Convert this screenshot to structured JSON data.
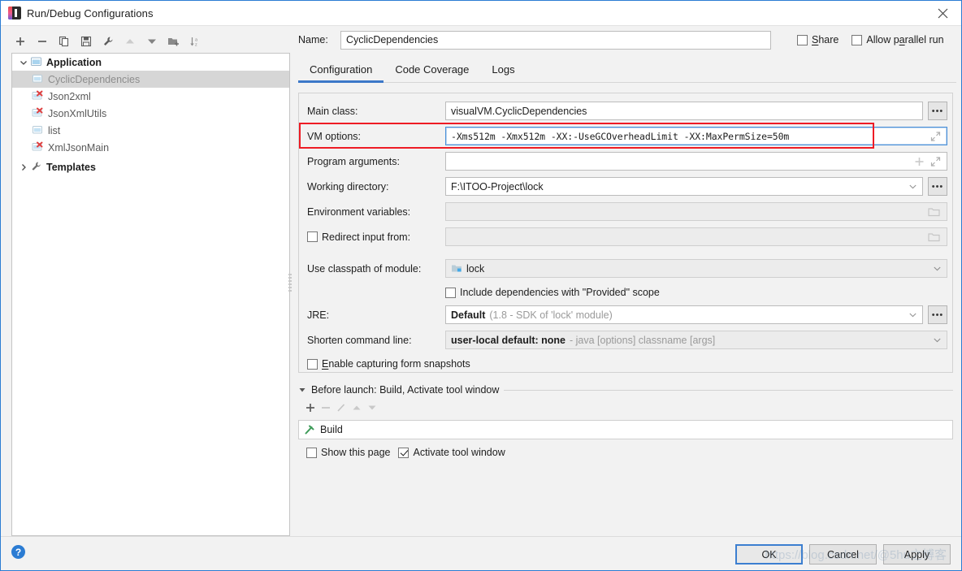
{
  "window": {
    "title": "Run/Debug Configurations",
    "close_label": "✕"
  },
  "tree_toolbar": {
    "buttons": [
      {
        "name": "add",
        "glyph": "+"
      },
      {
        "name": "remove",
        "glyph": "−"
      },
      {
        "name": "copy",
        "glyph": "copy-icon"
      },
      {
        "name": "save",
        "glyph": "save-icon"
      },
      {
        "name": "edit-templates",
        "glyph": "wrench-icon"
      },
      {
        "name": "move-up",
        "glyph": "triangle-up-icon"
      },
      {
        "name": "move-down",
        "glyph": "triangle-down-icon"
      },
      {
        "name": "new-folder",
        "glyph": "folder-add-icon"
      },
      {
        "name": "sort-alphabetically",
        "glyph": "sort-az-icon"
      }
    ]
  },
  "tree": {
    "groups": [
      {
        "label": "Application",
        "expanded": true,
        "items": [
          {
            "label": "CyclicDependencies",
            "selected": true,
            "error": false
          },
          {
            "label": "Json2xml",
            "selected": false,
            "error": true
          },
          {
            "label": "JsonXmlUtils",
            "selected": false,
            "error": true
          },
          {
            "label": "list",
            "selected": false,
            "error": false
          },
          {
            "label": "XmlJsonMain",
            "selected": false,
            "error": true
          }
        ]
      },
      {
        "label": "Templates",
        "expanded": false,
        "items": []
      }
    ]
  },
  "form": {
    "name_label": "Name:",
    "name_value": "CyclicDependencies",
    "share_label": "Share",
    "allow_parallel_label": "Allow parallel run",
    "share_checked": false,
    "allow_parallel_checked": false
  },
  "tabs": [
    {
      "label": "Configuration",
      "active": true
    },
    {
      "label": "Code Coverage",
      "active": false
    },
    {
      "label": "Logs",
      "active": false
    }
  ],
  "config": {
    "main_class_label": "Main class:",
    "main_class_value": "visualVM.CyclicDependencies",
    "vm_options_label": "VM options:",
    "vm_options_value": "-Xms512m -Xmx512m -XX:-UseGCOverheadLimit -XX:MaxPermSize=50m",
    "program_arguments_label": "Program arguments:",
    "program_arguments_value": "",
    "working_directory_label": "Working directory:",
    "working_directory_value": "F:\\ITOO-Project\\lock",
    "environment_variables_label": "Environment variables:",
    "environment_variables_value": "",
    "redirect_input_label": "Redirect input from:",
    "redirect_input_checked": false,
    "redirect_input_value": "",
    "use_classpath_label": "Use classpath of module:",
    "use_classpath_value": "lock",
    "include_provided_label": "Include dependencies with \"Provided\" scope",
    "include_provided_checked": false,
    "jre_label": "JRE:",
    "jre_value": "Default",
    "jre_hint": "(1.8 - SDK of 'lock' module)",
    "shorten_cmd_label": "Shorten command line:",
    "shorten_cmd_value": "user-local default: none",
    "shorten_cmd_hint": "- java [options] classname [args]",
    "enable_snapshots_label": "Enable capturing form snapshots",
    "enable_snapshots_checked": false,
    "browse_button_label": "•••",
    "highlight_color": "#ee1c25"
  },
  "before_launch": {
    "title": "Before launch: Build, Activate tool window",
    "toolbar": [
      {
        "name": "add-task",
        "glyph": "+"
      },
      {
        "name": "remove-task",
        "glyph": "−"
      },
      {
        "name": "edit-task",
        "glyph": "pencil-icon"
      },
      {
        "name": "move-task-up",
        "glyph": "triangle-up-icon"
      },
      {
        "name": "move-task-down",
        "glyph": "triangle-down-icon"
      }
    ],
    "tasks": [
      {
        "label": "Build",
        "icon": "build-hammer-icon"
      }
    ],
    "show_page_label": "Show this page",
    "show_page_checked": false,
    "activate_tool_window_label": "Activate tool window",
    "activate_tool_window_checked": true
  },
  "footer": {
    "help_label": "?",
    "ok_label": "OK",
    "cancel_label": "Cancel",
    "apply_label": "Apply",
    "watermark": "https://blog.csdn.net/@5hu之博客"
  }
}
